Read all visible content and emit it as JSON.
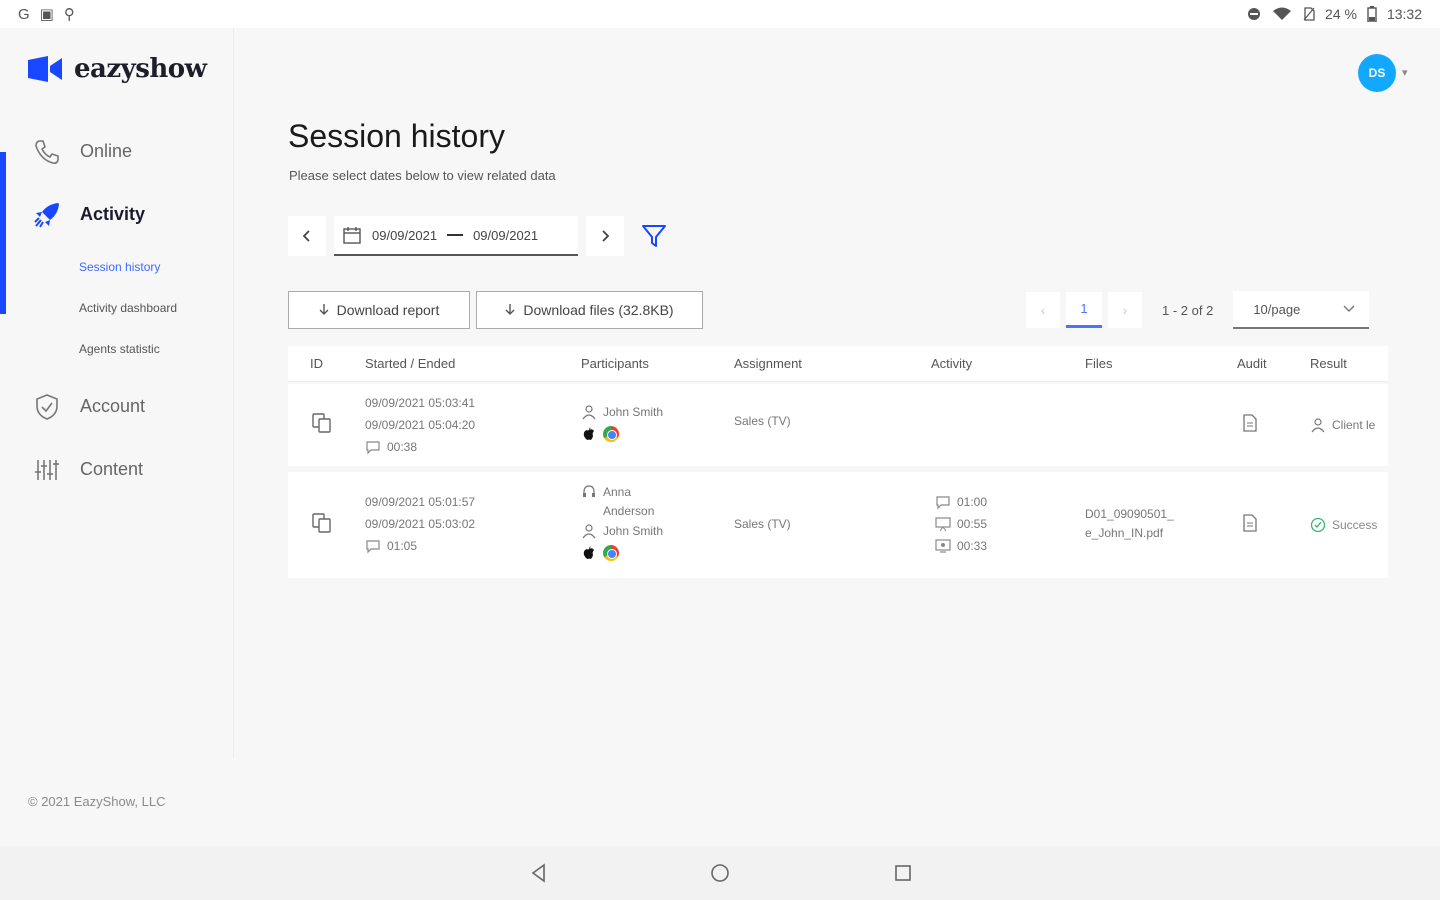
{
  "status_bar": {
    "left_icons": [
      "G",
      "▣",
      "⚲"
    ],
    "battery": "24 %",
    "time": "13:32"
  },
  "brand": {
    "name": "eazyshow",
    "color": "#1947ff"
  },
  "avatar": {
    "initials": "DS",
    "color": "#13a8ff"
  },
  "sidebar": {
    "items": [
      {
        "label": "Online",
        "icon": "phone-icon"
      },
      {
        "label": "Activity",
        "icon": "rocket-icon"
      },
      {
        "label": "Account",
        "icon": "shield-icon"
      },
      {
        "label": "Content",
        "icon": "sliders-icon"
      }
    ],
    "subitems": [
      {
        "label": "Session history"
      },
      {
        "label": "Activity dashboard"
      },
      {
        "label": "Agents statistic"
      }
    ]
  },
  "footer": "© 2021 EazyShow, LLC",
  "page": {
    "title": "Session history",
    "subtitle": "Please select dates below to view related data"
  },
  "date_range": {
    "start": "09/09/2021",
    "end": "09/09/2021"
  },
  "actions": {
    "download_report": "Download report",
    "download_files": "Download files (32.8KB)"
  },
  "pagination": {
    "page": "1",
    "range": "1 - 2 of 2",
    "page_size": "10/page"
  },
  "table": {
    "columns": [
      "ID",
      "Started / Ended",
      "Participants",
      "Assignment",
      "Activity",
      "Files",
      "Audit",
      "Result"
    ],
    "rows": [
      {
        "started": "09/09/2021 05:03:41",
        "ended": "09/09/2021 05:04:20",
        "duration": "00:38",
        "participants": [
          "John Smith"
        ],
        "assignment": "Sales (TV)",
        "activity": [],
        "files": "",
        "result": "Client le"
      },
      {
        "started": "09/09/2021 05:01:57",
        "ended": "09/09/2021 05:03:02",
        "duration": "01:05",
        "participants": [
          "Anna",
          "Anderson",
          "John Smith"
        ],
        "assignment": "Sales (TV)",
        "activity": [
          "01:00",
          "00:55",
          "00:33"
        ],
        "files": [
          "D01_09090501_",
          "e_John_IN.pdf"
        ],
        "result": "Success"
      }
    ]
  }
}
